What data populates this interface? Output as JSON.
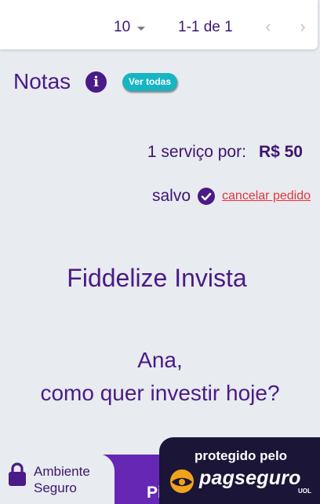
{
  "pagination": {
    "page_size": "10",
    "range_label": "1-1 de 1",
    "prev_icon": "chevron-left-icon",
    "next_icon": "chevron-right-icon"
  },
  "notas": {
    "title": "Notas",
    "info_icon": "info-icon",
    "ver_todas_label": "Ver todas"
  },
  "order": {
    "price_label": "1 serviço por:",
    "price_value": "R$ 50",
    "saved_label": "salvo",
    "saved_icon": "check-circle-icon",
    "cancel_label": "cancelar pedido"
  },
  "hero": {
    "brand": "Fiddelize Invista",
    "greeting_name": "Ana,",
    "greeting_question": "como quer investir hoje?"
  },
  "footer": {
    "secure_line1": "Ambiente",
    "secure_line2": "Seguro",
    "secure_icon": "lock-icon",
    "pix_label": "Pi",
    "protegido_label": "protegido pelo",
    "pagseguro_label": "pagseguro",
    "uol_label": "UOL"
  },
  "colors": {
    "primary_purple": "#4a1a87",
    "pix_purple": "#6527b4",
    "accent_teal": "#17b5c3",
    "danger_red": "#e0343f",
    "pagseguro_dark": "#1b1537",
    "background": "#e8ebef"
  }
}
